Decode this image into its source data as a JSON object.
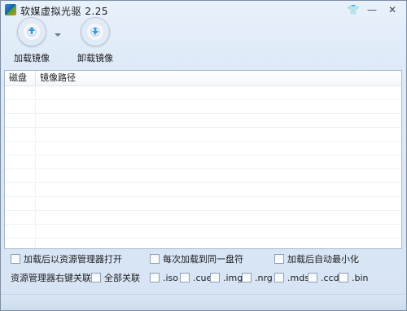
{
  "window": {
    "title": "软媒虚拟光驱 2.25"
  },
  "controls": {
    "skin": "👕",
    "minimize": "—",
    "close": "✕"
  },
  "toolbar": {
    "load_label": "加载镜像",
    "unload_label": "卸载镜像"
  },
  "list": {
    "columns": [
      "磁盘",
      "镜像路径"
    ]
  },
  "options": {
    "open_explorer": "加载后以资源管理器打开",
    "same_drive": "每次加载到同一盘符",
    "auto_minimize": "加载后自动最小化",
    "context_menu_label": "资源管理器右键关联",
    "associate_all": "全部关联",
    "ext": [
      ".iso",
      ".cue",
      ".img",
      ".nrg",
      ".mds",
      ".ccd",
      ".bin"
    ]
  }
}
